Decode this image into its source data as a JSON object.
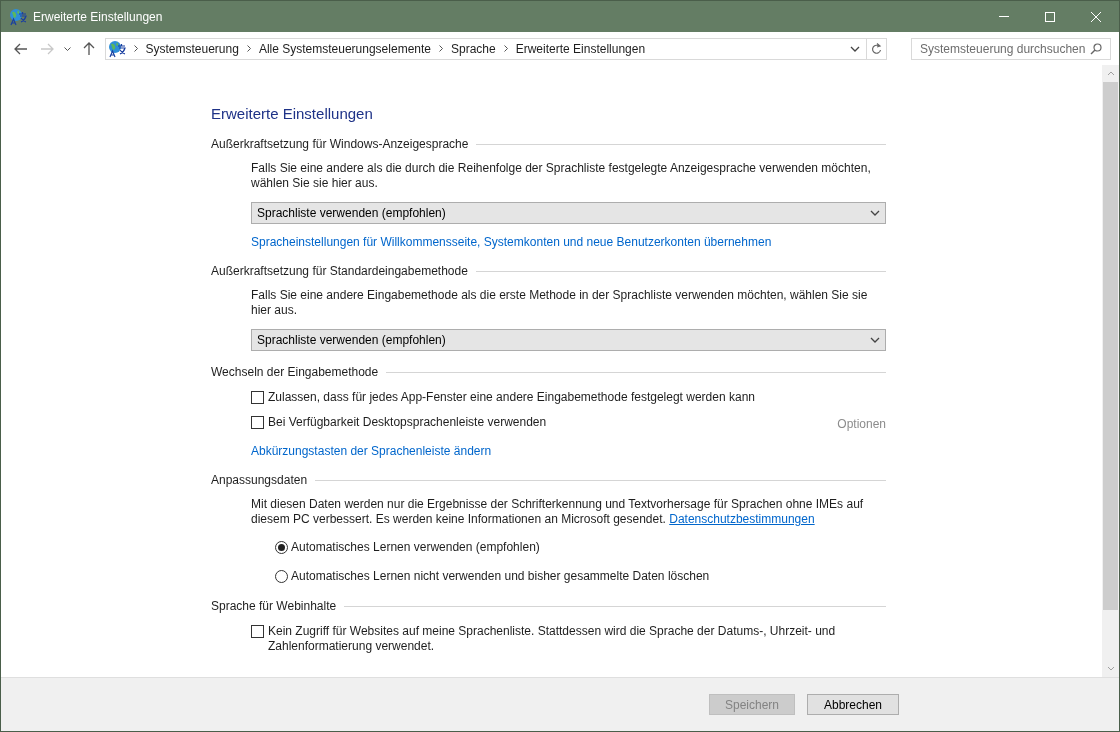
{
  "window": {
    "title": "Erweiterte Einstellungen"
  },
  "address_bar": {
    "breadcrumbs": [
      "Systemsteuerung",
      "Alle Systemsteuerungselemente",
      "Sprache",
      "Erweiterte Einstellungen"
    ]
  },
  "search": {
    "placeholder": "Systemsteuerung durchsuchen"
  },
  "page_title": "Erweiterte Einstellungen",
  "sections": [
    {
      "title": "Außerkraftsetzung für Windows-Anzeigesprache",
      "items": [
        {
          "kind": "paragraph",
          "text": "Falls Sie eine andere als die durch die Reihenfolge der Sprachliste festgelegte Anzeigesprache verwenden möchten, wählen Sie sie hier aus."
        },
        {
          "kind": "dropdown",
          "value": "Sprachliste verwenden (empfohlen)"
        },
        {
          "kind": "link",
          "text": "Spracheinstellungen für Willkommensseite, Systemkonten und neue Benutzerkonten übernehmen"
        }
      ]
    },
    {
      "title": "Außerkraftsetzung für Standardeingabemethode",
      "items": [
        {
          "kind": "paragraph",
          "text": "Falls Sie eine andere Eingabemethode als die erste Methode in der Sprachliste verwenden möchten, wählen Sie sie hier aus."
        },
        {
          "kind": "dropdown",
          "value": "Sprachliste verwenden (empfohlen)"
        }
      ]
    },
    {
      "title": "Wechseln der Eingabemethode",
      "items": [
        {
          "kind": "checkbox",
          "label": "Zulassen, dass für jedes App-Fenster eine andere Eingabemethode festgelegt werden kann",
          "checked": false
        },
        {
          "kind": "checkbox",
          "label": "Bei Verfügbarkeit Desktopsprachenleiste verwenden",
          "checked": false,
          "option": {
            "label": "Optionen",
            "disabled": true
          }
        },
        {
          "kind": "link",
          "text": "Abkürzungstasten der Sprachenleiste ändern"
        }
      ]
    },
    {
      "title": "Anpassungsdaten",
      "items": [
        {
          "kind": "paragraph",
          "text": "Mit diesen Daten werden nur die Ergebnisse der Schrifterkennung und Textvorhersage für Sprachen ohne IMEs auf diesem PC verbessert. Es werden keine Informationen an Microsoft gesendet.",
          "link": "Datenschutzbestimmungen"
        },
        {
          "kind": "radio",
          "label": "Automatisches Lernen verwenden (empfohlen)",
          "selected": true
        },
        {
          "kind": "radio",
          "label": "Automatisches Lernen nicht verwenden und bisher gesammelte Daten löschen",
          "selected": false
        }
      ]
    },
    {
      "title": "Sprache für Webinhalte",
      "items": [
        {
          "kind": "checkbox",
          "label": "Kein Zugriff für Websites auf meine Sprachenliste. Stattdessen wird die Sprache der Datums-, Uhrzeit- und Zahlenformatierung verwendet.",
          "checked": false
        }
      ]
    }
  ],
  "buttons": [
    {
      "label": "Speichern",
      "disabled": true
    },
    {
      "label": "Abbrechen",
      "disabled": false
    }
  ]
}
